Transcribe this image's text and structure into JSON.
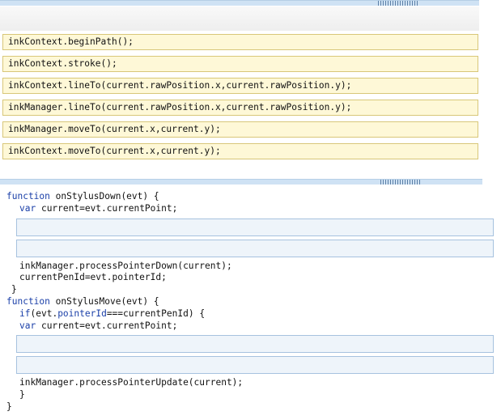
{
  "snippets": [
    "inkContext.beginPath();",
    "inkContext.stroke();",
    "inkContext.lineTo(current.rawPosition.x,current.rawPosition.y);",
    "inkManager.lineTo(current.rawPosition.x,current.rawPosition.y);",
    "inkManager.moveTo(current.x,current.y);",
    "inkContext.moveTo(current.x,current.y);"
  ],
  "code": {
    "kw_function": "function",
    "kw_var": "var",
    "kw_if": "if",
    "on_stylus_down_sig": " onStylusDown(evt) {",
    "down_current": " current=evt.currentPoint;",
    "process_down": "inkManager.processPointerDown(current);",
    "pen_id": "currentPenId=evt.pointerId;",
    "close_brace": "}",
    "on_stylus_move_sig": " onStylusMove(evt) {",
    "if_open": "(",
    "if_evt": "evt.",
    "if_pointer_id": "pointerId",
    "if_rest": "===currentPenId) {",
    "move_current": " current=evt.currentPoint;",
    "process_update": "inkManager.processPointerUpdate(current);"
  },
  "colors": {
    "snippet_bg": "#fef8d7",
    "snippet_border": "#d8c779",
    "drop_slot_bg": "#eef4fa",
    "drop_slot_border": "#a7c2df",
    "keyword": "#1a3fa8",
    "panel_bar": "#cfe2f4"
  }
}
